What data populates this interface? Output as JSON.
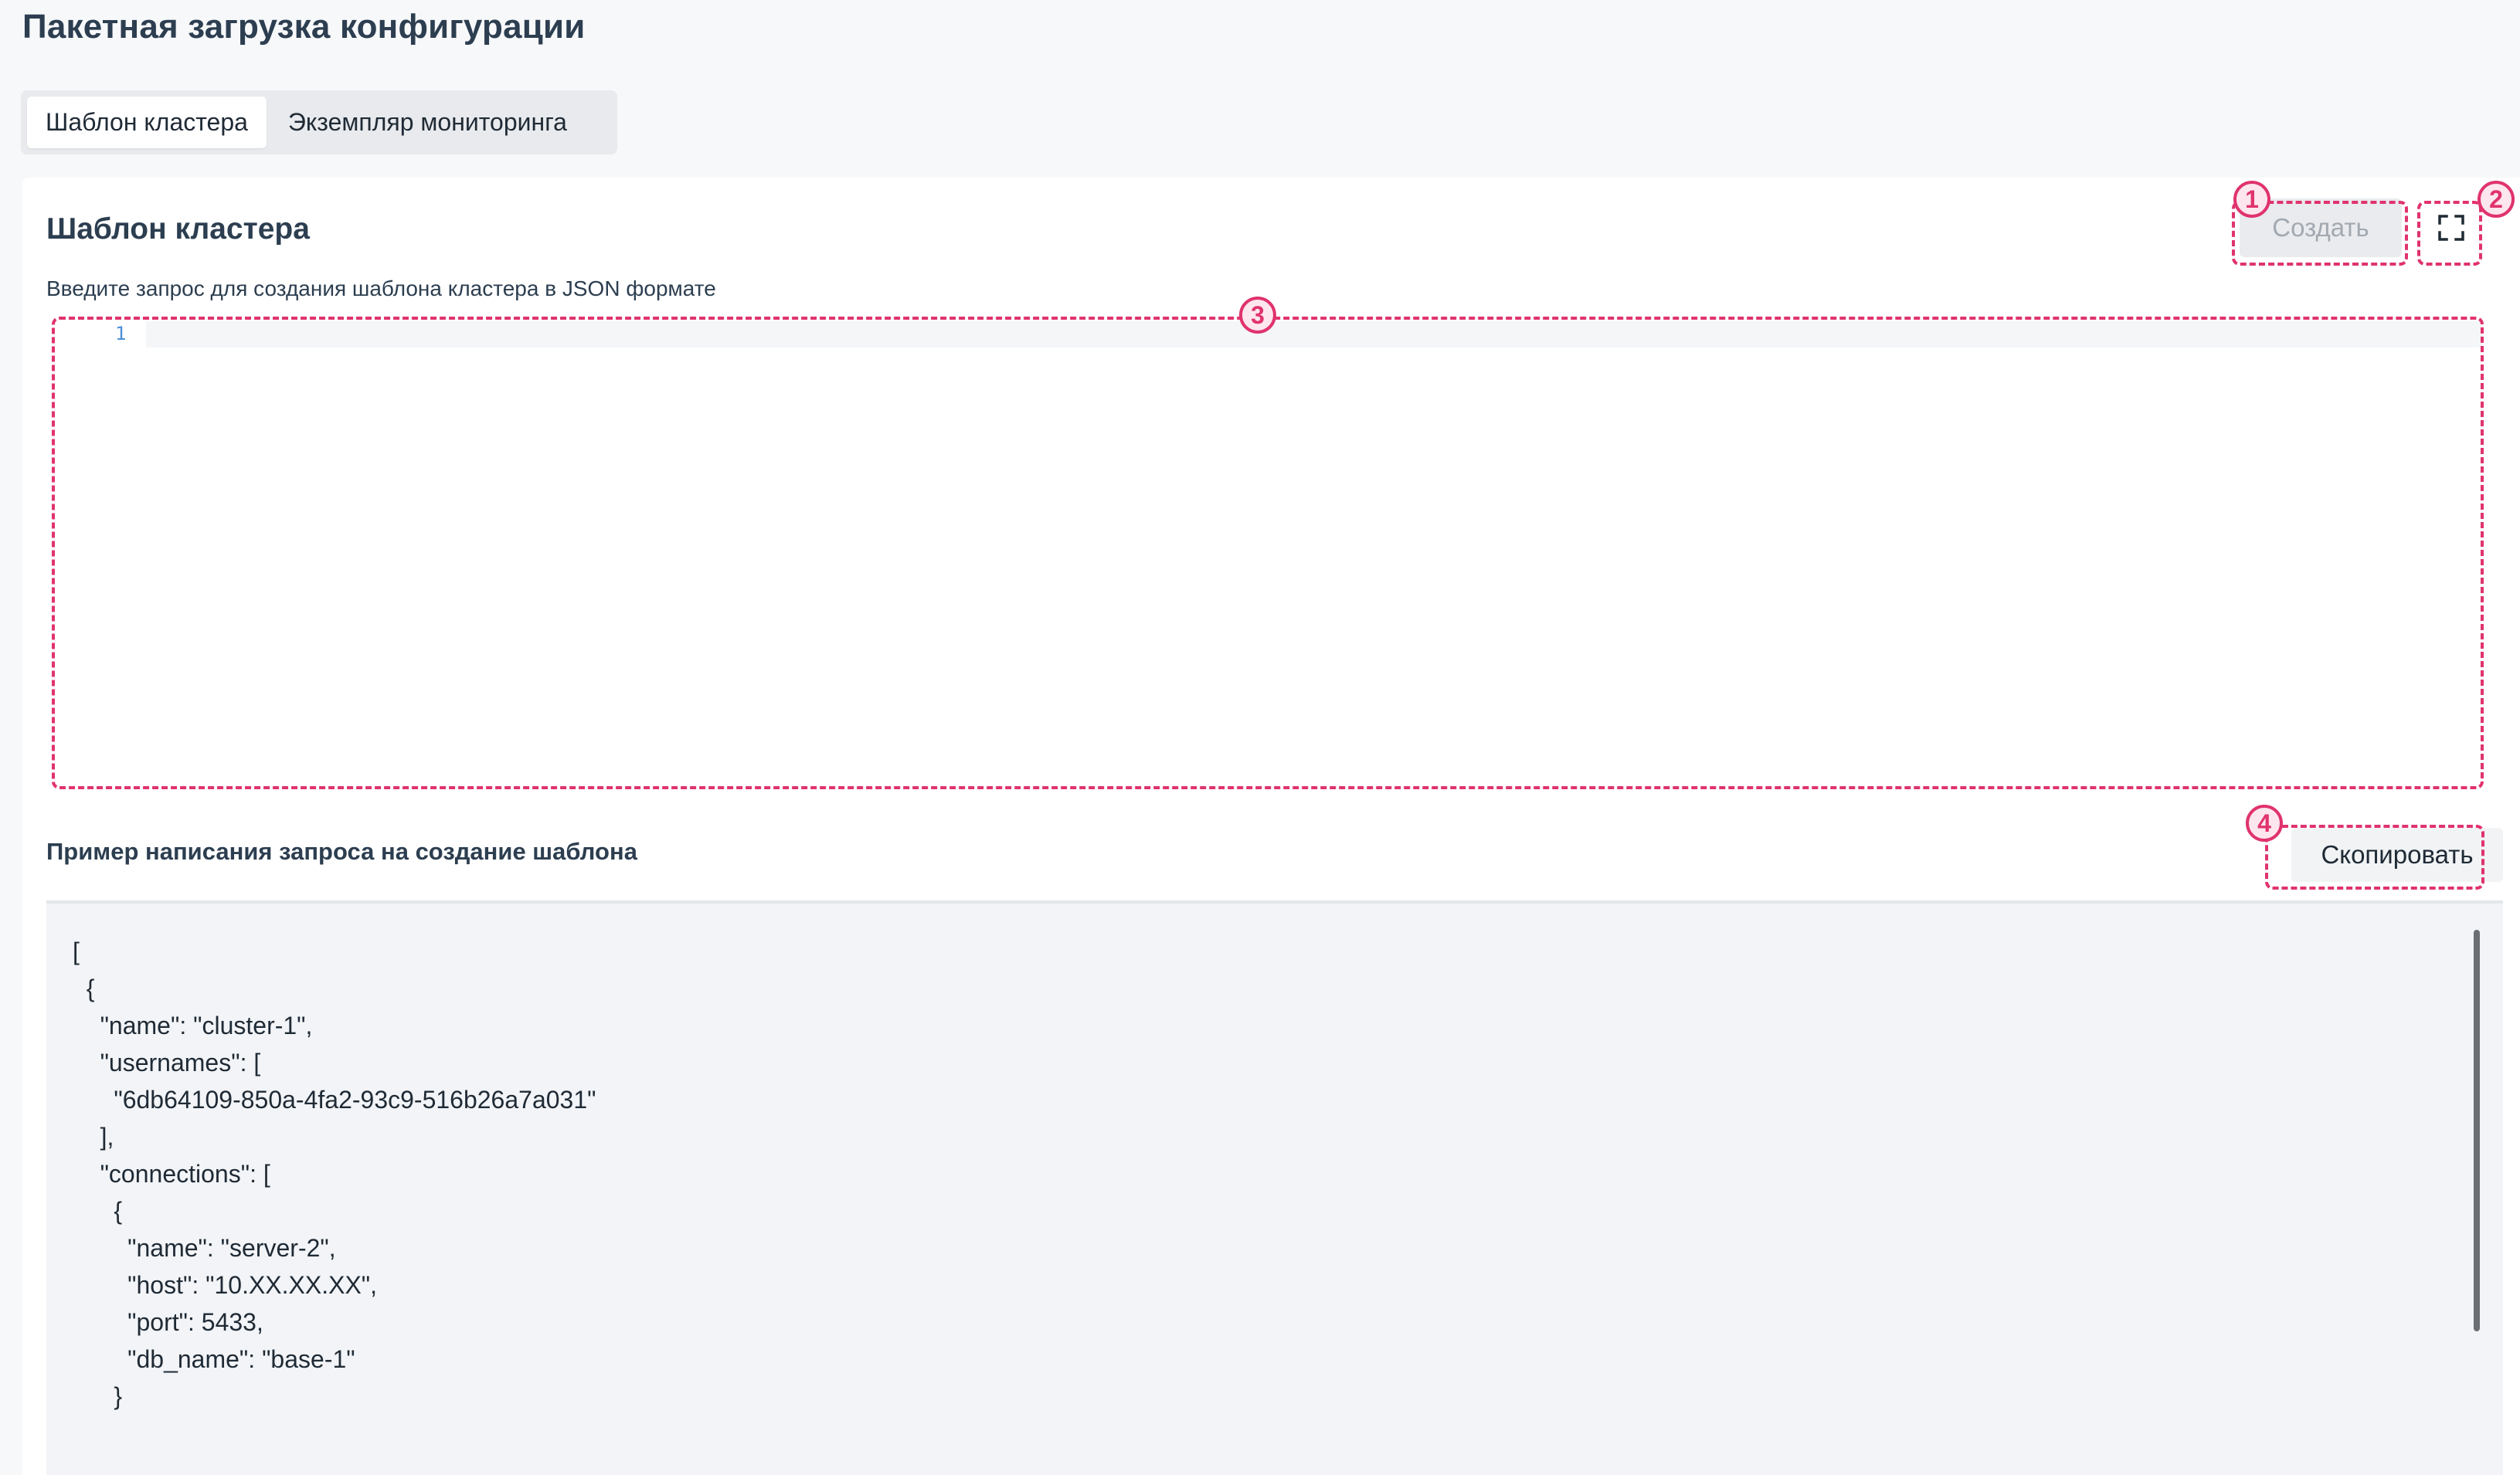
{
  "page": {
    "title": "Пакетная загрузка конфигурации"
  },
  "tabs": [
    {
      "label": "Шаблон кластера",
      "active": true
    },
    {
      "label": "Экземпляр мониторинга",
      "active": false
    }
  ],
  "card": {
    "title": "Шаблон кластера",
    "create_label": "Создать",
    "create_disabled": true,
    "expand_icon": "expand-icon",
    "hint": "Введите запрос для создания шаблона кластера в JSON формате",
    "editor": {
      "line_numbers": [
        "1"
      ],
      "content": ""
    },
    "example": {
      "title": "Пример написания запроса на создание шаблона",
      "copy_label": "Скопировать",
      "code_lines": [
        "[",
        "  {",
        "    \"name\": \"cluster-1\",",
        "    \"usernames\": [",
        "      \"6db64109-850a-4fa2-93c9-516b26a7a031\"",
        "    ],",
        "    \"connections\": [",
        "      {",
        "        \"name\": \"server-2\",",
        "        \"host\": \"10.XX.XX.XX\",",
        "        \"port\": 5433,",
        "        \"db_name\": \"base-1\"",
        "      }"
      ]
    }
  },
  "annotations": [
    "1",
    "2",
    "3",
    "4"
  ],
  "colors": {
    "annotation": "#e0336e",
    "background": "#f7f8fa",
    "code_background": "#f2f4f7"
  }
}
